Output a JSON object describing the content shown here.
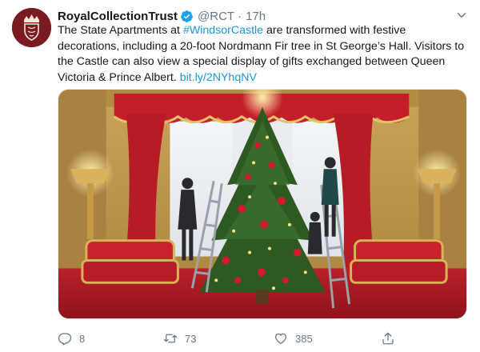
{
  "author": {
    "name": "RoyalCollectionTrust",
    "handle": "@RCT",
    "separator": "·",
    "time": "17h",
    "verified": true
  },
  "tweet": {
    "text_before_hashtag": "The State Apartments at ",
    "hashtag": "#WindsorCastle",
    "text_after_hashtag": " are transformed with festive decorations, including a 20-foot Nordmann Fir tree in St George’s Hall.  Visitors to the Castle can also view a special display of gifts exchanged between Queen Victoria & Prince Albert. ",
    "link": "bit.ly/2NYhqNV"
  },
  "media": {
    "alt": "Christmas tree being decorated in the red State Apartments"
  },
  "actions": {
    "reply_count": "8",
    "retweet_count": "73",
    "like_count": "385"
  },
  "icons": {
    "reply": "reply-icon",
    "retweet": "retweet-icon",
    "like": "heart-icon",
    "share": "share-icon",
    "more": "chevron-down-icon",
    "verified": "verified-badge-icon"
  },
  "colors": {
    "link": "#1b95e0",
    "muted": "#657786",
    "avatar_bg": "#7a1b22"
  }
}
